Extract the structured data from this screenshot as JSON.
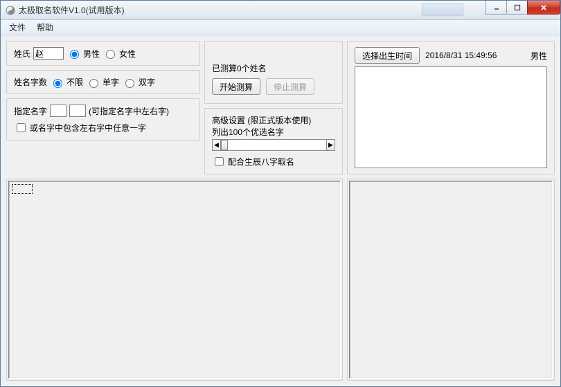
{
  "window": {
    "title": "太极取名软件V1.0(试用版本)"
  },
  "menu": {
    "file": "文件",
    "help": "帮助"
  },
  "surname": {
    "label": "姓氏",
    "value": "赵",
    "gender_male": "男性",
    "gender_female": "女性"
  },
  "name_chars": {
    "label": "姓名字数",
    "unlimited": "不限",
    "single": "单字",
    "double": "双字"
  },
  "specify": {
    "label": "指定名字",
    "hint": "(可指定名字中左右字)",
    "checkbox_label": "或名字中包含左右字中任意一字"
  },
  "calc": {
    "status": "已测算0个姓名",
    "start_btn": "开始测算",
    "stop_btn": "停止测算"
  },
  "advanced": {
    "title": "高级设置 (限正式版本使用)",
    "list_label": "列出100个优选名字",
    "bazi_checkbox": "配合生辰八字取名"
  },
  "birthtime": {
    "button": "选择出生时间",
    "datetime": "2016/8/31 15:49:56",
    "gender": "男性"
  }
}
